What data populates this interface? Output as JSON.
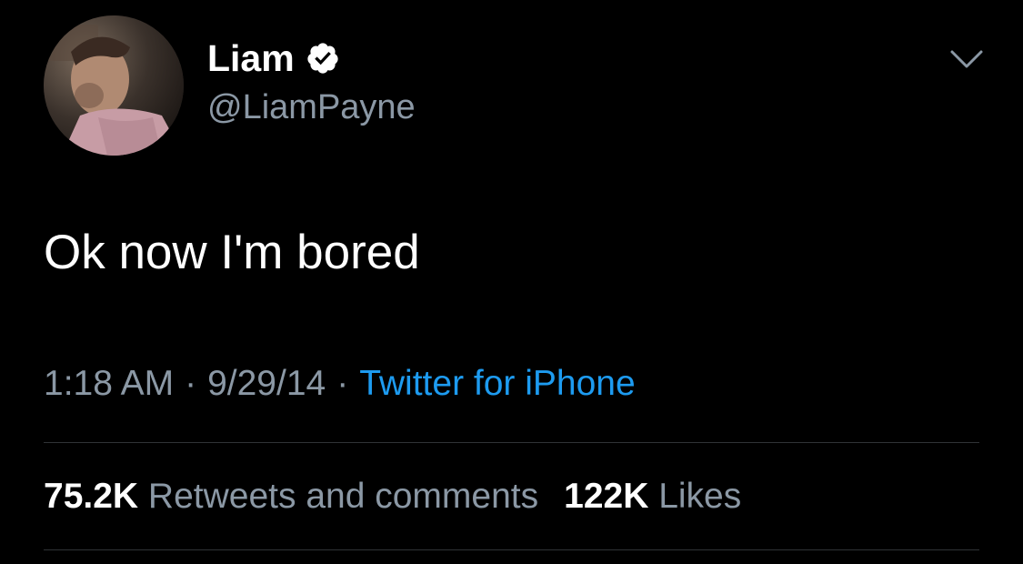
{
  "user": {
    "display_name": "Liam",
    "handle": "@LiamPayne",
    "verified": true,
    "avatar_icon": "profile-photo"
  },
  "tweet": {
    "text": "Ok now I'm bored"
  },
  "meta": {
    "time": "1:18 AM",
    "separator": "·",
    "date": "9/29/14",
    "source": "Twitter for iPhone"
  },
  "stats": {
    "retweets_count": "75.2K",
    "retweets_label": "Retweets and comments",
    "likes_count": "122K",
    "likes_label": "Likes"
  },
  "colors": {
    "background": "#000000",
    "text": "#ffffff",
    "secondary": "#8b98a5",
    "link": "#1d9bf0",
    "divider": "#2f3336",
    "verified_badge": "#ffffff"
  },
  "icons": {
    "verified": "verified-badge-icon",
    "menu": "chevron-down-icon"
  }
}
